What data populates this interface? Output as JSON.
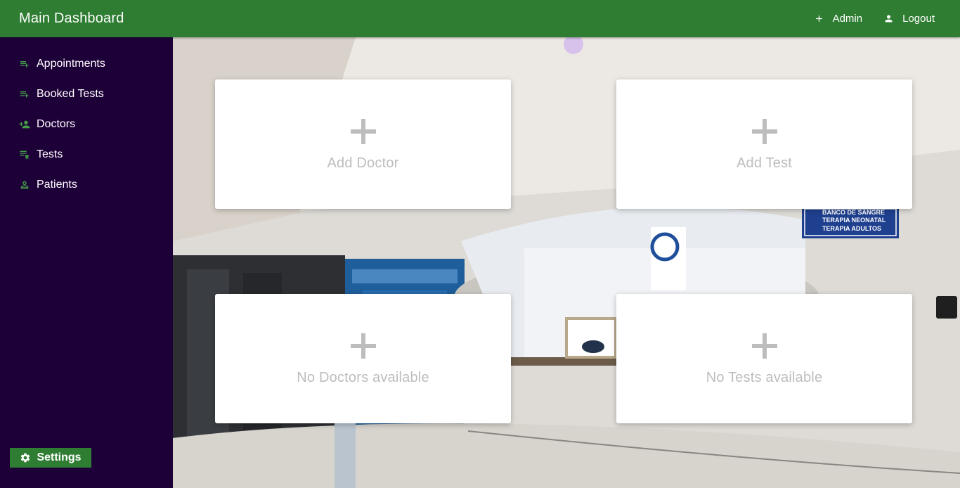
{
  "header": {
    "title": "Main Dashboard",
    "nav": [
      {
        "label": "Admin",
        "icon": "plus-icon"
      },
      {
        "label": "Logout",
        "icon": "user-icon"
      }
    ]
  },
  "sidebar": {
    "items": [
      {
        "label": "Appointments",
        "icon": "playlist-add-icon"
      },
      {
        "label": "Booked Tests",
        "icon": "playlist-add-icon"
      },
      {
        "label": "Doctors",
        "icon": "person-add-icon"
      },
      {
        "label": "Tests",
        "icon": "lab-cart-icon"
      },
      {
        "label": "Patients",
        "icon": "person-icon"
      }
    ],
    "settings_label": "Settings"
  },
  "cards": {
    "add_doctor": "Add Doctor",
    "add_test": "Add Test",
    "no_doctors": "No Doctors available",
    "no_tests": "No Tests available"
  },
  "wall_sign": {
    "lines": [
      "BANCO DE SANGRE",
      "TERAPIA NEONATAL",
      "TERAPIA ADULTOS"
    ]
  },
  "colors": {
    "topbar": "#2e7d32",
    "sidebar": "#1e0038",
    "accent_icon": "#43a047",
    "card_text": "#bdbdbd"
  }
}
